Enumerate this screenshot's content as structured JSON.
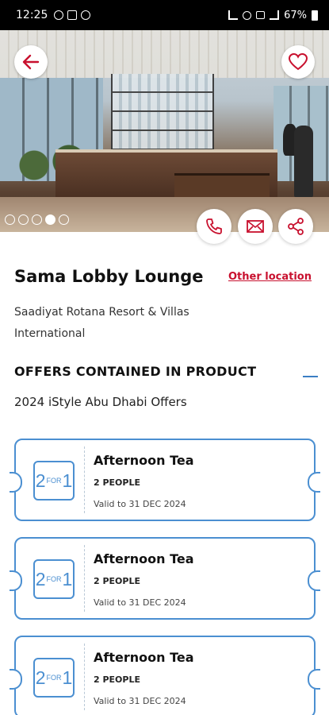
{
  "status_bar": {
    "time": "12:25",
    "battery": "67%"
  },
  "hero": {
    "image_alt": "Sama Lobby Lounge interior",
    "gallery_count": 5,
    "gallery_active_index": 3
  },
  "venue": {
    "name": "Sama Lobby Lounge",
    "other_location_label": "Other location",
    "hotel": "Saadiyat Rotana Resort & Villas International"
  },
  "offers_section": {
    "heading": "OFFERS CONTAINED IN PRODUCT",
    "group_name": "2024 iStyle Abu Dhabi Offers",
    "offers": [
      {
        "badge_num1": "2",
        "badge_text": "FOR",
        "badge_num2": "1",
        "title": "Afternoon Tea",
        "people": "2 PEOPLE",
        "validity": "Valid to 31 DEC 2024"
      },
      {
        "badge_num1": "2",
        "badge_text": "FOR",
        "badge_num2": "1",
        "title": "Afternoon Tea",
        "people": "2 PEOPLE",
        "validity": "Valid to 31 DEC 2024"
      },
      {
        "badge_num1": "2",
        "badge_text": "FOR",
        "badge_num2": "1",
        "title": "Afternoon Tea",
        "people": "2 PEOPLE",
        "validity": "Valid to 31 DEC 2024"
      }
    ]
  },
  "colors": {
    "accent_red": "#c8102e",
    "accent_blue": "#4b8fd1"
  },
  "icons": [
    "back-arrow-icon",
    "heart-icon",
    "phone-icon",
    "mail-icon",
    "share-icon",
    "collapse-icon"
  ]
}
